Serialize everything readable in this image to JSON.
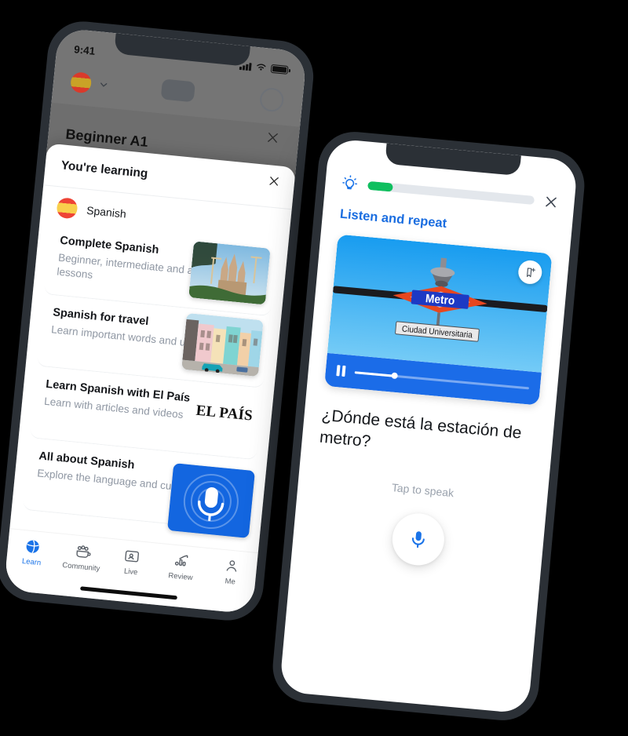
{
  "phone_left": {
    "status_bar": {
      "time": "9:41",
      "signal_icon": "signal-bars-icon",
      "wifi_icon": "wifi-icon",
      "battery_icon": "battery-icon"
    },
    "header": {
      "flag_icon": "spanish-flag-icon",
      "chevron_icon": "chevron-down-icon",
      "avatar_icon": "profile-ring-icon"
    },
    "behind": {
      "title": "Beginner A1",
      "close_icon": "close-icon"
    },
    "sheet": {
      "title": "You're learning",
      "close_icon": "close-icon",
      "language": {
        "label": "Spanish",
        "flag_icon": "spanish-flag-icon"
      },
      "courses": [
        {
          "title": "Complete Spanish",
          "subtitle": "Beginner, intermediate and advanced lessons",
          "media": "sagrada-familia-photo"
        },
        {
          "title": "Spanish for travel",
          "subtitle": "Learn important words and useful phrases",
          "media": "havana-street-photo"
        },
        {
          "title": "Learn Spanish with El País",
          "subtitle": "Learn with articles and videos",
          "media": "el-pais-logo",
          "logo_text": "EL PAÍS"
        },
        {
          "title": "All about Spanish",
          "subtitle": "Explore the language and culture",
          "media": "podcast-microphone-tile"
        }
      ]
    },
    "tabbar": [
      {
        "label": "Learn",
        "icon": "globe-icon",
        "active": true
      },
      {
        "label": "Community",
        "icon": "community-people-icon",
        "active": false
      },
      {
        "label": "Live",
        "icon": "live-person-card-icon",
        "active": false
      },
      {
        "label": "Review",
        "icon": "review-chart-icon",
        "active": false
      },
      {
        "label": "Me",
        "icon": "person-icon",
        "active": false
      }
    ]
  },
  "phone_right": {
    "hint_icon": "lightbulb-icon",
    "close_icon": "close-icon",
    "progress_percent": 15,
    "progress_color": "#0fbf5f",
    "heading": "Listen and repeat",
    "media": {
      "image": "madrid-metro-sign-photo",
      "sign_text": "Metro",
      "station_text": "Ciudad Universitaria",
      "bookmark_icon": "bookmark-add-icon",
      "pause_icon": "pause-icon",
      "scrub_percent": 23
    },
    "prompt": "¿Dónde está la estación de metro?",
    "tap_hint": "Tap to speak",
    "mic_icon": "microphone-icon"
  },
  "colors": {
    "accent_blue": "#1a73e8",
    "progress_green": "#0fbf5f",
    "frame": "#2b3036"
  }
}
